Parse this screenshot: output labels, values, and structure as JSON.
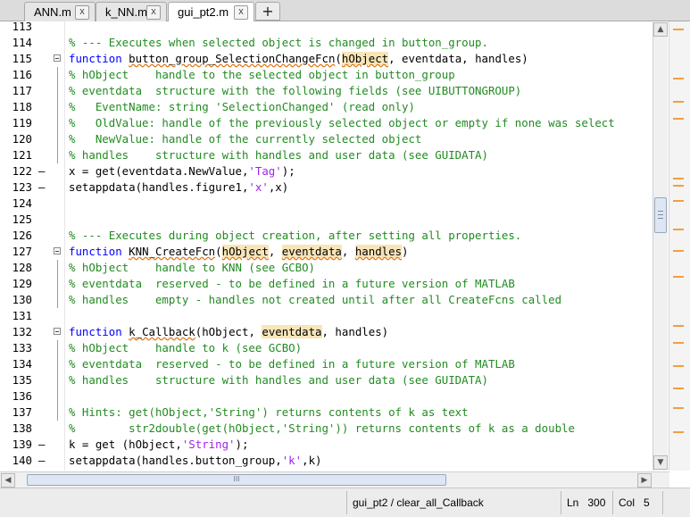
{
  "tabs": [
    {
      "label": "ANN.m",
      "close": "x"
    },
    {
      "label": "k_NN.m",
      "close": "x"
    },
    {
      "label": "gui_pt2.m",
      "close": "x"
    }
  ],
  "add_tab_label": "+",
  "editor": {
    "lines": [
      {
        "num": "113",
        "dash": ""
      },
      {
        "num": "114",
        "dash": ""
      },
      {
        "num": "115",
        "dash": ""
      },
      {
        "num": "116",
        "dash": ""
      },
      {
        "num": "117",
        "dash": ""
      },
      {
        "num": "118",
        "dash": ""
      },
      {
        "num": "119",
        "dash": ""
      },
      {
        "num": "120",
        "dash": ""
      },
      {
        "num": "121",
        "dash": ""
      },
      {
        "num": "122",
        "dash": "—"
      },
      {
        "num": "123",
        "dash": "—"
      },
      {
        "num": "124",
        "dash": ""
      },
      {
        "num": "125",
        "dash": ""
      },
      {
        "num": "126",
        "dash": ""
      },
      {
        "num": "127",
        "dash": ""
      },
      {
        "num": "128",
        "dash": ""
      },
      {
        "num": "129",
        "dash": ""
      },
      {
        "num": "130",
        "dash": ""
      },
      {
        "num": "131",
        "dash": ""
      },
      {
        "num": "132",
        "dash": ""
      },
      {
        "num": "133",
        "dash": ""
      },
      {
        "num": "134",
        "dash": ""
      },
      {
        "num": "135",
        "dash": ""
      },
      {
        "num": "136",
        "dash": ""
      },
      {
        "num": "137",
        "dash": ""
      },
      {
        "num": "138",
        "dash": ""
      },
      {
        "num": "139",
        "dash": "—"
      },
      {
        "num": "140",
        "dash": "—"
      }
    ],
    "code": {
      "l114": "% --- Executes when selected object is changed in button_group.",
      "l115_kw": "function",
      "l115_name": "button_group_SelectionChangeFcn",
      "l115_arg1": "hObject",
      "l115_rest": ", eventdata, handles)",
      "l116": "% hObject    handle to the selected object in button_group",
      "l117": "% eventdata  structure with the following fields (see UIBUTTONGROUP)",
      "l118": "%   EventName: string 'SelectionChanged' (read only)",
      "l119": "%   OldValue: handle of the previously selected object or empty if none was select",
      "l120": "%   NewValue: handle of the currently selected object",
      "l121": "% handles    structure with handles and user data (see GUIDATA)",
      "l122_a": "x = get(eventdata.NewValue,",
      "l122_s": "'Tag'",
      "l122_b": ");",
      "l123_a": "setappdata(handles.figure1,",
      "l123_s": "'x'",
      "l123_b": ",x)",
      "l126": "% --- Executes during object creation, after setting all properties.",
      "l127_kw": "function",
      "l127_name": "KNN_CreateFcn",
      "l127_arg1": "hObject",
      "l127_arg2": "eventdata",
      "l127_arg3": "handles",
      "l128": "% hObject    handle to KNN (see GCBO)",
      "l129": "% eventdata  reserved - to be defined in a future version of MATLAB",
      "l130": "% handles    empty - handles not created until after all CreateFcns called",
      "l132_kw": "function",
      "l132_name": "k_Callback",
      "l132_a": "(hObject, ",
      "l132_arg": "eventdata",
      "l132_b": ", handles)",
      "l133": "% hObject    handle to k (see GCBO)",
      "l134": "% eventdata  reserved - to be defined in a future version of MATLAB",
      "l135": "% handles    structure with handles and user data (see GUIDATA)",
      "l137": "% Hints: get(hObject,'String') returns contents of k as text",
      "l138": "%        str2double(get(hObject,'String')) returns contents of k as a double",
      "l139_a": "k = get (hObject,",
      "l139_s": "'String'",
      "l139_b": ");",
      "l140_a": "setappdata(handles.button_group,",
      "l140_s": "'k'",
      "l140_b": ",k)"
    }
  },
  "hscroll_grip": "III",
  "status": {
    "function": "gui_pt2 / clear_all_Callback",
    "ln_label": "Ln",
    "ln_value": "300",
    "col_label": "Col",
    "col_value": "5"
  },
  "colors": {
    "comment": "#228b22",
    "keyword": "#0000ff",
    "string": "#a020f0",
    "highlight": "#f8e5b8",
    "marker": "#f0a040"
  }
}
